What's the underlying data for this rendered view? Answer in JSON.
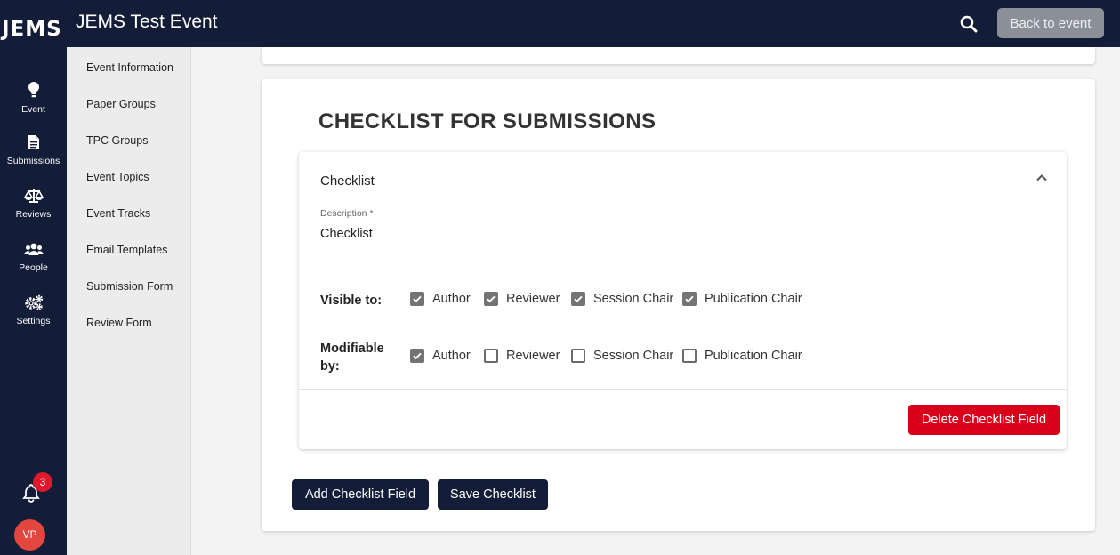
{
  "app": {
    "logo": "JEMS",
    "title": "JEMS Test Event",
    "back_label": "Back to event",
    "search_icon": "search-icon"
  },
  "rail": {
    "items": [
      {
        "label": "Event",
        "icon": "lightbulb-icon"
      },
      {
        "label": "Submissions",
        "icon": "document-icon"
      },
      {
        "label": "Reviews",
        "icon": "scale-icon"
      },
      {
        "label": "People",
        "icon": "people-icon"
      },
      {
        "label": "Settings",
        "icon": "gears-icon"
      }
    ],
    "notifications": {
      "count": "3",
      "icon": "bell-icon"
    },
    "avatar_initials": "VP"
  },
  "subnav": {
    "items": [
      {
        "label": "Event Information"
      },
      {
        "label": "Paper Groups"
      },
      {
        "label": "TPC Groups"
      },
      {
        "label": "Event Topics"
      },
      {
        "label": "Event Tracks"
      },
      {
        "label": "Email Templates"
      },
      {
        "label": "Submission Form"
      },
      {
        "label": "Review Form"
      }
    ]
  },
  "main": {
    "section_title": "CHECKLIST FOR SUBMISSIONS",
    "panel": {
      "title": "Checklist",
      "description_label": "Description *",
      "description_value": "Checklist",
      "visible_label": "Visible to:",
      "modifiable_label_line1": "Modifiable",
      "modifiable_label_line2": "by:",
      "visible_to": [
        {
          "label": "Author",
          "checked": true
        },
        {
          "label": "Reviewer",
          "checked": true
        },
        {
          "label": "Session Chair",
          "checked": true
        },
        {
          "label": "Publication Chair",
          "checked": true
        }
      ],
      "modifiable_by": [
        {
          "label": "Author",
          "checked": true
        },
        {
          "label": "Reviewer",
          "checked": false
        },
        {
          "label": "Session Chair",
          "checked": false
        },
        {
          "label": "Publication Chair",
          "checked": false
        }
      ],
      "delete_label": "Delete Checklist Field"
    },
    "add_label": "Add Checklist Field",
    "save_label": "Save Checklist"
  },
  "colors": {
    "navy": "#141d38",
    "danger": "#d9001b",
    "badge": "#e0182b",
    "avatar": "#e2463e",
    "back_button": "#8a8f98"
  }
}
